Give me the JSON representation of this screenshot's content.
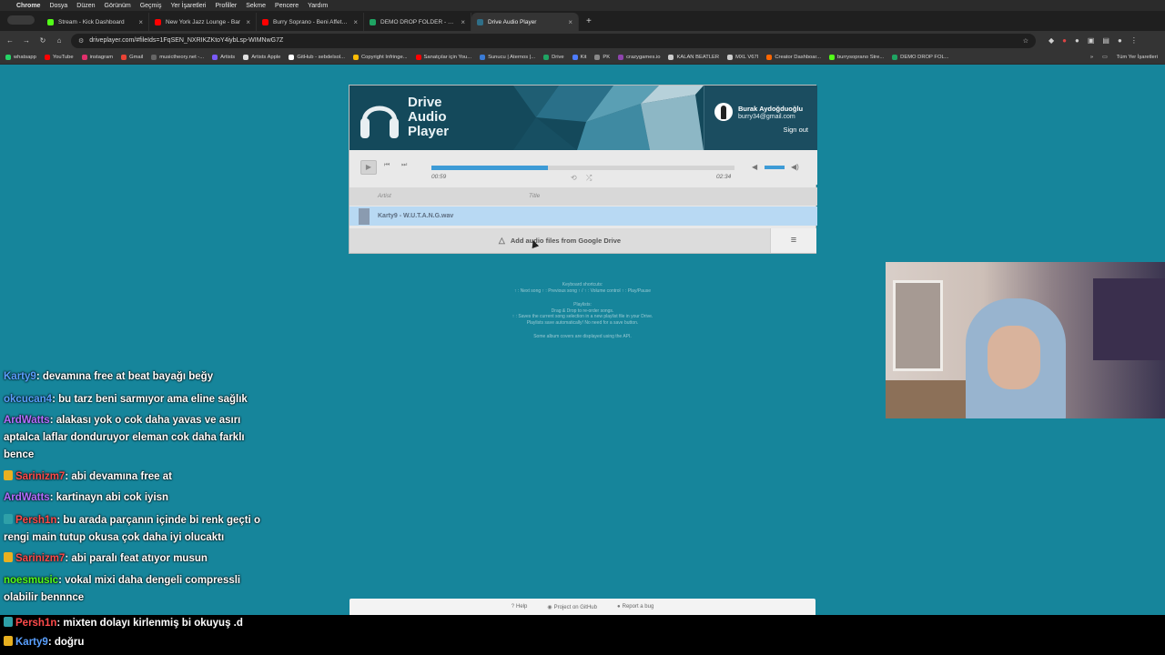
{
  "menubar": {
    "app": "Chrome",
    "items": [
      "Dosya",
      "Düzen",
      "Görünüm",
      "Geçmiş",
      "Yer İşaretleri",
      "Profiller",
      "Sekme",
      "Pencere",
      "Yardım"
    ]
  },
  "tabs": [
    {
      "title": "Stream - Kick Dashboard",
      "fav_color": "#53fc18",
      "icon": "kick-icon"
    },
    {
      "title": "New York Jazz Lounge - Bar",
      "fav_color": "#ff0000",
      "icon": "youtube-icon"
    },
    {
      "title": "Burry Soprano - Beni Affet Ta",
      "fav_color": "#ff0000",
      "icon": "youtube-icon"
    },
    {
      "title": "DEMO DROP FOLDER - Goog",
      "fav_color": "#1fa463",
      "icon": "drive-icon"
    },
    {
      "title": "Drive Audio Player",
      "fav_color": "#2f6f88",
      "icon": "player-icon"
    }
  ],
  "address": {
    "url": "driveplayer.com/#fileIds=1FqSEN_NXRIKZKtoY4iybLsp-WIMNwG7Z"
  },
  "bookmarks": [
    {
      "label": "whatsapp",
      "color": "#25d366"
    },
    {
      "label": "YouTube",
      "color": "#ff0000"
    },
    {
      "label": "instagram",
      "color": "#e1306c"
    },
    {
      "label": "Gmail",
      "color": "#ea4335"
    },
    {
      "label": "musictheory.net -...",
      "color": "#666666"
    },
    {
      "label": "Artists",
      "color": "#7a5af8"
    },
    {
      "label": "Artists Apple",
      "color": "#e0e0e0"
    },
    {
      "label": "GitHub - sebdelsol...",
      "color": "#ffffff"
    },
    {
      "label": "Copyright Infringe...",
      "color": "#fbbc05"
    },
    {
      "label": "Sanatçılar için You...",
      "color": "#ff0000"
    },
    {
      "label": "Sunucu | Aternos |...",
      "color": "#3a7bd5"
    },
    {
      "label": "Drive",
      "color": "#1fa463"
    },
    {
      "label": "Kit",
      "color": "#4d7cfe"
    },
    {
      "label": "PK",
      "color": "#888888"
    },
    {
      "label": "crazygames.io",
      "color": "#8e44ad"
    },
    {
      "label": "KALAN BEATLER",
      "color": "#cccccc"
    },
    {
      "label": "MXL V67I",
      "color": "#cccccc"
    },
    {
      "label": "Creator Dashboar...",
      "color": "#ff6600"
    },
    {
      "label": "burrysoprano Stre...",
      "color": "#53fc18"
    },
    {
      "label": "DEMO DROP FOL...",
      "color": "#1fa463"
    }
  ],
  "bookmarks_right": "Tüm Yer İşaretleri",
  "player": {
    "logo_lines": [
      "Drive",
      "Audio",
      "Player"
    ],
    "user_name": "Burak Aydoğduoğlu",
    "user_email": "burry34@gmail.com",
    "sign_out": "Sign out",
    "current_time": "00:59",
    "total_time": "02:34",
    "progress_fraction": 0.385,
    "volume_fraction": 1.0,
    "col_artist": "Artist",
    "col_title": "Title",
    "track": "Karty9 - W.U.T.A.N.G.wav",
    "add_files": "Add audio files from Google Drive",
    "accent": "#3d9bd6"
  },
  "help": {
    "kb_title": "Keyboard shortcuts:",
    "kb_line": "↑ : Next song  ↑ : Previous song  ↑ / ↑ : Volume control  ↑ : Play/Pause",
    "pl_title": "Playlists:",
    "pl_line1": "Drag & Drop to re-order songs.",
    "pl_line2": "↑ : Saves the current song selection in a new playlist file in your Drive.",
    "pl_line3": "Playlists save automatically! No need for a save button.",
    "covers_line": "Some album covers are displayed using the        API."
  },
  "chat": [
    {
      "user": "Karty9",
      "text": ": devamına free at beat bayağı beğy",
      "color": "#5aa0ff",
      "badge": "none"
    },
    {
      "user": "okcucan4",
      "text": ": bu tarz beni sarmıyor ama eline sağlık",
      "color": "#5aa0ff",
      "badge": "none"
    },
    {
      "user": "ArdWatts",
      "text": ": alakası yok o cok daha yavas ve asırı aptalca laflar donduruyor eleman cok daha farklı bence",
      "color": "#b56cff",
      "badge": "none"
    },
    {
      "user": "Sarinizm7",
      "text": ": abi devamına free at",
      "color": "#ff4b4b",
      "badge": "sub"
    },
    {
      "user": "ArdWatts",
      "text": ": kartinayn abi cok iyisn",
      "color": "#b56cff",
      "badge": "none"
    },
    {
      "user": "Persh1n",
      "text": ": bu arada parçanın içinde bi renk geçti o rengi main tutup okusa çok daha iyi olucaktı",
      "color": "#ff4b4b",
      "badge": "mod"
    },
    {
      "user": "Sarinizm7",
      "text": ": abi paralı feat atıyor musun",
      "color": "#ff4b4b",
      "badge": "sub"
    },
    {
      "user": "noesmusic",
      "text": ": vokal mixi daha dengeli compressli olabilir bennnce",
      "color": "#53fc18",
      "badge": "none"
    },
    {
      "user": "Persh1n",
      "text": ": mixten dolayı kirlenmiş bi okuyuş .d",
      "color": "#ff4b4b",
      "badge": "mod"
    },
    {
      "user": "Karty9",
      "text": ": doğru",
      "color": "#5aa0ff",
      "badge": "sub"
    }
  ],
  "footer": {
    "help": "Help",
    "github": "Project on GitHub",
    "bug": "Report a bug"
  }
}
